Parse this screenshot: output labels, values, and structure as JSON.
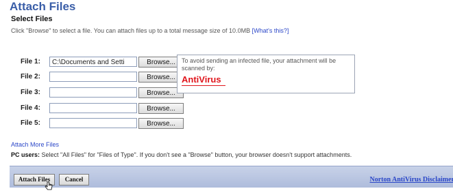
{
  "page": {
    "title": "Attach Files",
    "subtitle": "Select Files",
    "instructions": "Click \"Browse\" to select a file. You can attach files up to a total message size of 10.0MB",
    "whats_this_link": "[What's this?]"
  },
  "files": [
    {
      "label": "File 1:",
      "value": "C:\\Documents and Setti",
      "browse": "Browse..."
    },
    {
      "label": "File 2:",
      "value": "",
      "browse": "Browse..."
    },
    {
      "label": "File 3:",
      "value": "",
      "browse": "Browse..."
    },
    {
      "label": "File 4:",
      "value": "",
      "browse": "Browse..."
    },
    {
      "label": "File 5:",
      "value": "",
      "browse": "Browse..."
    }
  ],
  "antivirus": {
    "message": "To avoid sending an infected file, your attachment will be scanned by:",
    "logo_text": "AntiVirus",
    "logo_color": "#e0141b"
  },
  "links": {
    "attach_more": "Attach More Files"
  },
  "pc_note": {
    "label": "PC users:",
    "text": "Select \"All Files\" for \"Files of Type\". If you don't see a \"Browse\" button, your browser doesn't support attachments."
  },
  "footer": {
    "attach_button": "Attach Files",
    "cancel_button": "Cancel",
    "disclaimer_link": "Norton AntiVirus Disclaimer"
  },
  "colors": {
    "title": "#3a5ea8",
    "link": "#2b47c8",
    "footer_bg": "#b9c6e2"
  },
  "icons": {
    "cursor": "hand-pointer-icon"
  }
}
